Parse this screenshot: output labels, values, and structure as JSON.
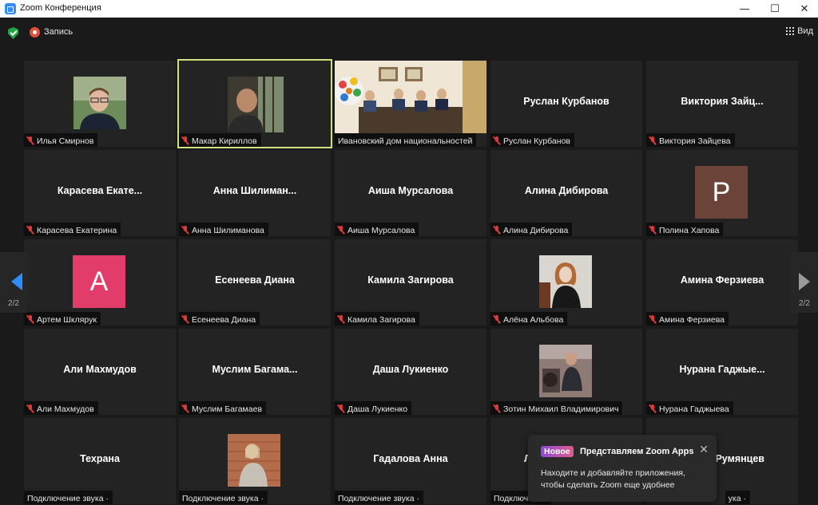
{
  "window": {
    "title": "Zoom Конференция",
    "minimize": "—",
    "maximize": "☐",
    "close": "✕"
  },
  "topbar": {
    "record_label": "Запись",
    "view_label": "Вид"
  },
  "tiles": [
    {
      "label": "Илья Смирнов",
      "big": "",
      "kind": "photo"
    },
    {
      "label": "Макар Кириллов",
      "big": "",
      "kind": "video"
    },
    {
      "label": "Ивановский дом национальностей",
      "big": "",
      "kind": "video"
    },
    {
      "label": "Руслан Курбанов",
      "big": "Руслан Курбанов",
      "kind": "name"
    },
    {
      "label": "Виктория Зайцева",
      "big": "Виктория  Зайц...",
      "kind": "name"
    },
    {
      "label": "Карасева Екатерина",
      "big": "Карасева  Екате...",
      "kind": "name"
    },
    {
      "label": "Анна Шилиманова",
      "big": "Анна  Шилиман...",
      "kind": "name"
    },
    {
      "label": "Аиша Мурсалова",
      "big": "Аиша Мурсалова",
      "kind": "name"
    },
    {
      "label": "Алина Дибирова",
      "big": "Алина Дибирова",
      "kind": "name"
    },
    {
      "label": "Полина Хапова",
      "big": "",
      "kind": "letter",
      "letter": "P",
      "color": "#6b4339"
    },
    {
      "label": "Артем Шклярук",
      "big": "",
      "kind": "letter",
      "letter": "A",
      "color": "#e23c6a"
    },
    {
      "label": "Есенеева Диана",
      "big": "Есенеева Диана",
      "kind": "name"
    },
    {
      "label": "Камила Загирова",
      "big": "Камила Загирова",
      "kind": "name"
    },
    {
      "label": "Алёна Альбова",
      "big": "",
      "kind": "photo"
    },
    {
      "label": "Амина Ферзиева",
      "big": "Амина Ферзиева",
      "kind": "name"
    },
    {
      "label": "Али Махмудов",
      "big": "Али Махмудов",
      "kind": "name"
    },
    {
      "label": "Муслим Багамаев",
      "big": "Муслим  Багама...",
      "kind": "name"
    },
    {
      "label": "Даша Лукиенко",
      "big": "Даша Лукиенко",
      "kind": "name"
    },
    {
      "label": "Зотин Михаил Владимирович",
      "big": "",
      "kind": "photo"
    },
    {
      "label": "Нурана Гаджыева",
      "big": "Нурана  Гаджые...",
      "kind": "name"
    },
    {
      "label": "Подключение звука ·",
      "big": "Техрана",
      "kind": "name"
    },
    {
      "label": "Подключение звука ·",
      "big": "",
      "kind": "photo"
    },
    {
      "label": "Подключение звука ·",
      "big": "Гадалова Анна",
      "kind": "name"
    },
    {
      "label": "Подключение",
      "big": "Л",
      "kind": "name"
    },
    {
      "label": "ука ·",
      "big": "Румянцев",
      "kind": "name"
    }
  ],
  "nav": {
    "page": "2/2"
  },
  "popup": {
    "badge": "Новое",
    "title": "Представляем Zoom Apps",
    "body": "Находите и добавляйте приложения, чтобы сделать Zoom еще удобнее",
    "close": "✕"
  }
}
